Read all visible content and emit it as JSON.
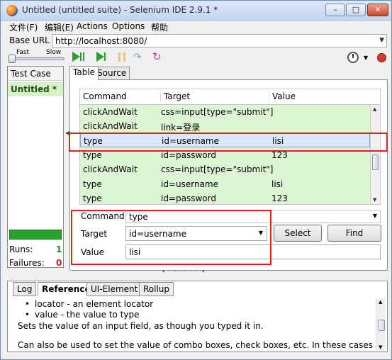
{
  "window": {
    "title": "Untitled (untitled suite) - Selenium IDE 2.9.1 *"
  },
  "menu": [
    "文件(F)",
    "编辑(E)",
    "Actions",
    "Options",
    "帮助"
  ],
  "base_url": {
    "label": "Base URL",
    "value": "http://localhost:8080/"
  },
  "toolbar": {
    "fast_label": "Fast",
    "slow_label": "Slow",
    "speed_level": 0
  },
  "test_case_panel": {
    "header": "Test Case",
    "items": [
      "Untitled *"
    ],
    "runs_label": "Runs:",
    "runs_value": "1",
    "failures_label": "Failures:",
    "failures_value": "0",
    "progress": 1.0
  },
  "tabs": [
    "Table",
    "Source"
  ],
  "table": {
    "headers": [
      "Command",
      "Target",
      "Value"
    ],
    "rows": [
      {
        "command": "clickAndWait",
        "target": "css=input[type=\"submit\"]",
        "value": ""
      },
      {
        "command": "clickAndWait",
        "target": "link=登录",
        "value": ""
      },
      {
        "command": "type",
        "target": "id=username",
        "value": "lisi"
      },
      {
        "command": "type",
        "target": "id=password",
        "value": "123"
      },
      {
        "command": "clickAndWait",
        "target": "css=input[type=\"submit\"]",
        "value": ""
      },
      {
        "command": "type",
        "target": "id=username",
        "value": "lisi"
      },
      {
        "command": "type",
        "target": "id=password",
        "value": "123"
      }
    ],
    "selected_row": 2
  },
  "editor": {
    "command_label": "Command",
    "command_value": "type",
    "target_label": "Target",
    "target_value": "id=username",
    "value_label": "Value",
    "value_value": "lisi",
    "select_button": "Select",
    "find_button": "Find"
  },
  "bottom_tabs": [
    "Log",
    "Reference",
    "UI-Element",
    "Rollup"
  ],
  "reference": {
    "bullets": [
      "locator - an element locator",
      "value - the value to type"
    ],
    "line1": "Sets the value of an input field, as though you typed it in.",
    "line2": "Can also be used to set the value of combo boxes, check boxes, etc. In these cases, value"
  },
  "colors": {
    "highlight": "#e0201e",
    "pass_green": "#2aa12a",
    "row_green": "#dcf5d3"
  }
}
